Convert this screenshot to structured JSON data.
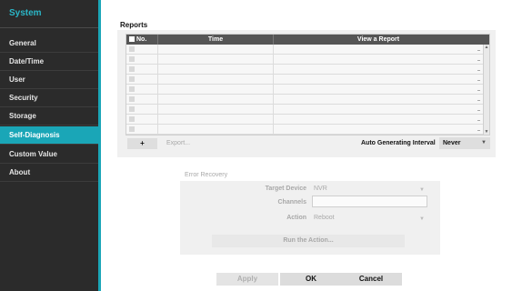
{
  "sidebar": {
    "title": "System",
    "items": [
      {
        "label": "General"
      },
      {
        "label": "Date/Time"
      },
      {
        "label": "User"
      },
      {
        "label": "Security"
      },
      {
        "label": "Storage"
      },
      {
        "label": "Self-Diagnosis"
      },
      {
        "label": "Custom Value"
      },
      {
        "label": "About"
      }
    ],
    "active_item": "Self-Diagnosis",
    "accent_color": "#1aa6b7"
  },
  "reports": {
    "title": "Reports",
    "columns": [
      "No.",
      "Time",
      "View a Report"
    ],
    "rows": 9,
    "add_button": "+",
    "export_button": "Export...",
    "auto_interval_label": "Auto Generating Interval",
    "auto_interval_value": "Never"
  },
  "error_recovery": {
    "title": "Error Recovery",
    "target_device_label": "Target Device",
    "target_device_value": "NVR",
    "channels_label": "Channels",
    "channels_value": "",
    "action_label": "Action",
    "action_value": "Reboot",
    "run_button": "Run the Action..."
  },
  "footer": {
    "apply": "Apply",
    "ok": "OK",
    "cancel": "Cancel"
  }
}
